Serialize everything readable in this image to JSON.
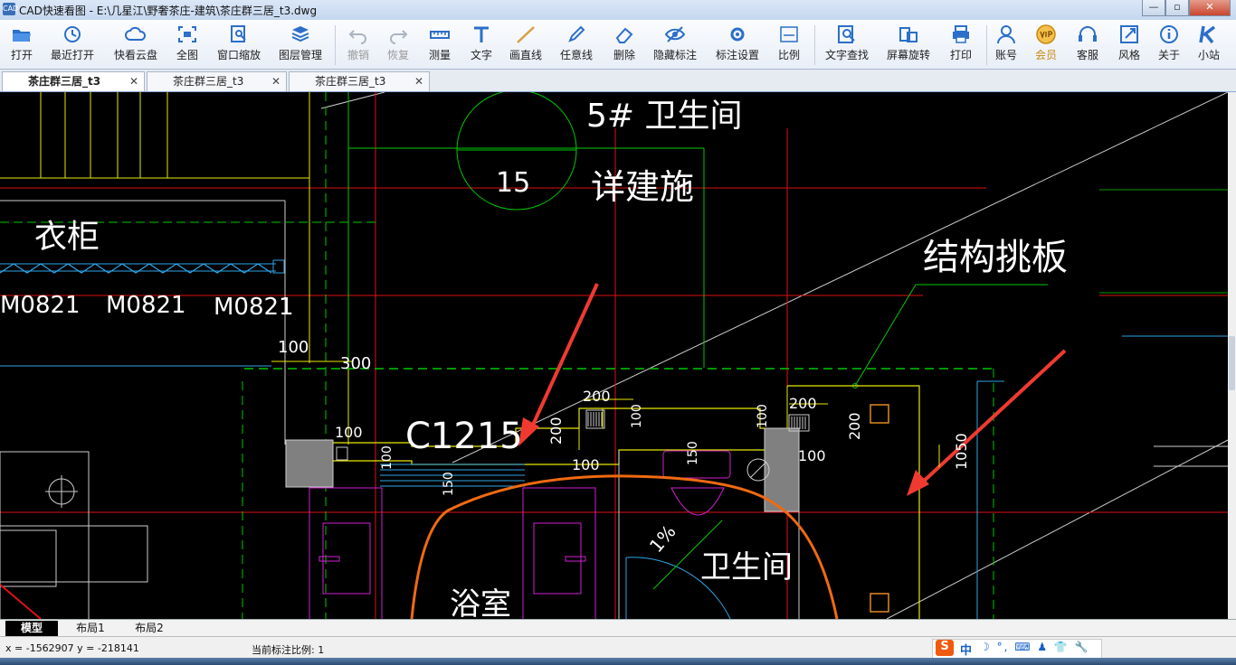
{
  "window": {
    "app_icon": "CAD",
    "title": "CAD快速看图 - E:\\几星江\\野奢茶庄-建筑\\茶庄群三居_t3.dwg",
    "minimize": "—",
    "maximize": "▫",
    "close": "✕"
  },
  "toolbar": {
    "items": [
      {
        "label": "打开",
        "icon": "folder-open-icon"
      },
      {
        "label": "最近打开",
        "icon": "recent-icon"
      },
      {
        "label": "快看云盘",
        "icon": "cloud-icon"
      },
      {
        "label": "全图",
        "icon": "fit-all-icon"
      },
      {
        "label": "窗口缩放",
        "icon": "zoom-window-icon"
      },
      {
        "label": "图层管理",
        "icon": "layers-icon"
      },
      {
        "label": "撤销",
        "icon": "undo-icon"
      },
      {
        "label": "恢复",
        "icon": "redo-icon"
      },
      {
        "label": "测量",
        "icon": "measure-icon"
      },
      {
        "label": "文字",
        "icon": "text-icon"
      },
      {
        "label": "画直线",
        "icon": "line-icon"
      },
      {
        "label": "任意线",
        "icon": "pen-icon"
      },
      {
        "label": "删除",
        "icon": "eraser-icon"
      },
      {
        "label": "隐藏标注",
        "icon": "hide-eye-icon"
      },
      {
        "label": "标注设置",
        "icon": "annotation-settings-icon"
      },
      {
        "label": "比例",
        "icon": "ratio-icon"
      },
      {
        "label": "文字查找",
        "icon": "text-search-icon"
      },
      {
        "label": "屏幕旋转",
        "icon": "rotate-screen-icon"
      },
      {
        "label": "打印",
        "icon": "printer-icon"
      },
      {
        "label": "账号",
        "icon": "account-icon"
      },
      {
        "label": "会员",
        "icon": "vip-icon"
      },
      {
        "label": "客服",
        "icon": "headset-icon"
      },
      {
        "label": "风格",
        "icon": "style-icon"
      },
      {
        "label": "关于",
        "icon": "info-icon"
      },
      {
        "label": "小站",
        "icon": "k-site-icon"
      }
    ]
  },
  "tabs": [
    {
      "label": "茶庄群三居_t3",
      "close": "✕"
    },
    {
      "label": "茶庄群三居_t3",
      "close": "✕"
    },
    {
      "label": "茶庄群三居_t3",
      "close": "✕"
    }
  ],
  "drawing": {
    "room_5": "5# 卫生间",
    "detail_no": "15",
    "detail_ref": "详建施",
    "wardrobe": "衣柜",
    "struct_plate": "结构挑板",
    "door_1": "M0821",
    "door_2": "M0821",
    "door_3": "M0821",
    "window": "C1215",
    "bath": "浴室",
    "toilet": "卫生间",
    "slope": "1%",
    "dim_100a": "100",
    "dim_300": "300",
    "dim_100b": "100",
    "dim_200a": "200",
    "dim_200b": "200",
    "dim_200c": "200",
    "dim_200d": "200",
    "dim_100c": "100",
    "dim_100d": "100",
    "dim_100e": "100",
    "dim_100f": "100",
    "dim_150a": "150",
    "dim_150b": "150",
    "dim_1050": "1050",
    "dim_100g": "100"
  },
  "layouts": [
    "模型",
    "布局1",
    "布局2"
  ],
  "status": {
    "coords": "x = -1562907  y = -218141",
    "scale": "当前标注比例: 1"
  },
  "ime": {
    "logo": "S",
    "mode": "中",
    "icons": "☽ °, ⌨ ♟ 👕 🔧"
  }
}
